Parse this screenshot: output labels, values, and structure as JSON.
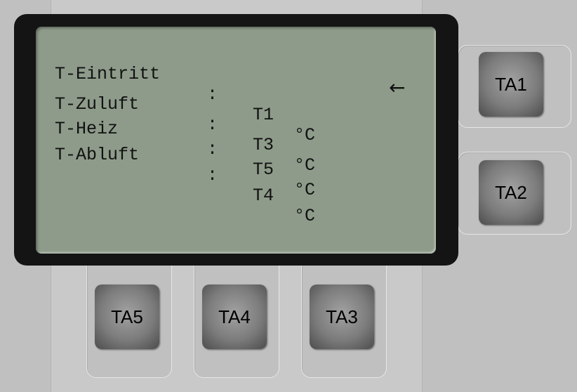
{
  "display": {
    "rows": [
      {
        "label": "T-Eintritt",
        "separator": ":",
        "sensor": "T1",
        "unit": "°C"
      },
      {
        "label": "T-Zuluft",
        "separator": ":",
        "sensor": "T3",
        "unit": "°C"
      },
      {
        "label": "T-Heiz",
        "separator": ":",
        "sensor": "T5",
        "unit": "°C"
      },
      {
        "label": "T-Abluft",
        "separator": ":",
        "sensor": "T4",
        "unit": "°C"
      }
    ],
    "cursor": "←",
    "cursor_row": 2
  },
  "keys": {
    "ta1": "TA1",
    "ta2": "TA2",
    "ta3": "TA3",
    "ta4": "TA4",
    "ta5": "TA5"
  },
  "colors": {
    "lcd_background": "#8e9b8a",
    "bezel": "#141414",
    "panel": "#c9c9c9"
  }
}
